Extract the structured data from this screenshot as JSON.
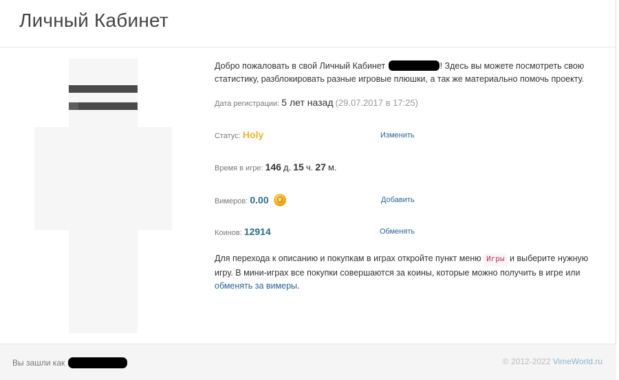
{
  "header": {
    "title": "Личный Кабинет"
  },
  "intro": {
    "part1": "Добро пожаловать в свой Личный Кабинет",
    "part2": "! Здесь вы можете посмотреть свою статистику, разблокировать разные игровые плюшки, а так же материально помочь проекту."
  },
  "registration": {
    "label": "Дата регистрации:",
    "ago": "5 лет назад",
    "date": "(29.07.2017 в 17:25)"
  },
  "status": {
    "label": "Статус:",
    "value": "Holy",
    "action": "Изменить"
  },
  "playtime": {
    "label": "Время в игре:",
    "days": "146",
    "days_unit": "д.",
    "hours": "15",
    "hours_unit": "ч.",
    "minutes": "27",
    "minutes_unit": "м."
  },
  "vimers": {
    "label": "Вимеров:",
    "value": "0.00",
    "icon": "coin-icon",
    "action": "Добавить"
  },
  "coins": {
    "label": "Коинов:",
    "value": "12914",
    "action": "Обменять"
  },
  "help": {
    "text1": "Для перехода к описанию и покупкам в играх откройте пункт меню",
    "menu_item": "Игры",
    "text2": "и выберите нужную игру. В мини-играх все покупки совершаются за коины, которые можно получить в игре или",
    "link": "обменять за вимеры",
    "text3": "."
  },
  "footer": {
    "logged_in_as": "Вы зашли как",
    "copyright": "© 2012-2022",
    "brand": "VimeWorld.ru"
  },
  "colors": {
    "status_gold": "#f0b52a",
    "value_teal": "#2b6c8f",
    "link": "#2a6496"
  }
}
